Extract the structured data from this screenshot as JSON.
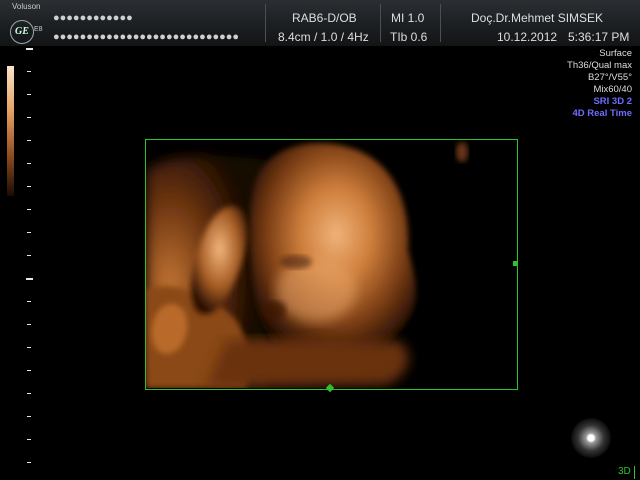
{
  "header": {
    "brand": "Voluson",
    "model": "E8",
    "logo_text": "GE",
    "patient_id_masked": "●●●●●●●●●●●●",
    "patient_name_masked": "●●●●●●●●●●●●●●●●●●●●●●●●●●●●",
    "probe": "RAB6-D/OB",
    "depth_params": "8.4cm / 1.0 / 4Hz",
    "mi": "MI 1.0",
    "tib": "TIb 0.6",
    "institution": "Doç.Dr.Mehmet SIMSEK",
    "date": "10.12.2012",
    "time": "5:36:17 PM"
  },
  "render_info": {
    "lines": [
      "Surface",
      "Th36/Qual max",
      "B27°/V55°",
      "Mix60/40"
    ],
    "highlight_lines": [
      "SRI 3D 2",
      "4D Real Time"
    ]
  },
  "footer": {
    "mode_label": "3D"
  },
  "colors": {
    "roi_border": "#2fc02f",
    "highlight_text": "#6f6cff",
    "skin_tone": "#c9793a"
  },
  "icons": [
    "ge-logo-icon",
    "light-source-icon"
  ]
}
